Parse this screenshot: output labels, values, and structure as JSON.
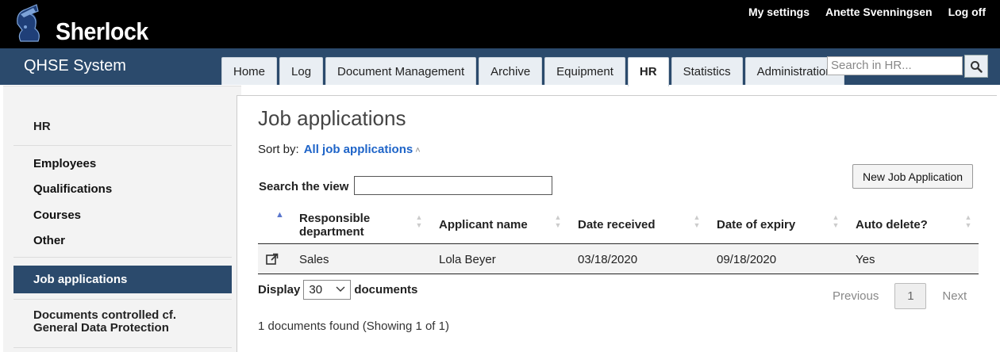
{
  "header": {
    "logo_text": "Sherlock",
    "links": [
      "My settings",
      "Anette Svenningsen",
      "Log off"
    ]
  },
  "nav": {
    "brand": "QHSE System",
    "tabs": [
      "Home",
      "Log",
      "Document Management",
      "Archive",
      "Equipment",
      "HR",
      "Statistics",
      "Administration"
    ],
    "active_tab": "HR",
    "search_placeholder": "Search in HR...",
    "search_icon": "search-icon"
  },
  "sidebar": {
    "heading": "HR",
    "items": [
      "Employees",
      "Qualifications",
      "Courses",
      "Other"
    ],
    "active_item": "Job applications",
    "last_item": "Documents controlled cf. General Data Protection"
  },
  "main": {
    "title": "Job applications",
    "sort_label": "Sort by:",
    "sort_value": "All job applications",
    "new_button": "New Job Application",
    "search_label": "Search the view",
    "search_value": "",
    "columns": [
      "Responsible department",
      "Applicant name",
      "Date received",
      "Date of expiry",
      "Auto delete?"
    ],
    "rows": [
      {
        "department": "Sales",
        "applicant": "Lola Beyer",
        "received": "03/18/2020",
        "expiry": "09/18/2020",
        "auto_delete": "Yes"
      }
    ],
    "display_label": "Display",
    "page_size": "30",
    "documents_label": "documents",
    "pager": {
      "previous": "Previous",
      "current": "1",
      "next": "Next"
    },
    "found_text": "1 documents found (Showing 1 of 1)"
  },
  "colors": {
    "navy": "#2b4a6c",
    "link_blue": "#1e64c8",
    "black_bar": "#000000"
  }
}
